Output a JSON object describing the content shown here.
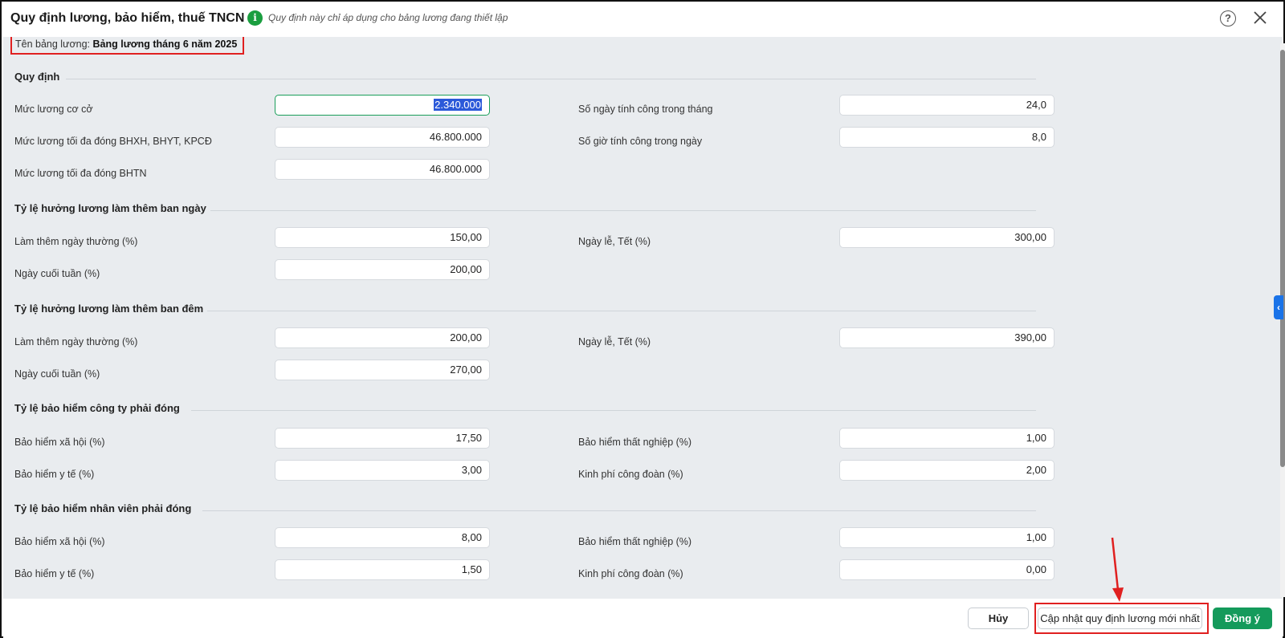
{
  "dialog": {
    "title": "Quy định lương, bảo hiểm, thuế TNCN",
    "info_note": "Quy định này chỉ áp dụng cho bảng lương đang thiết lập",
    "help_symbol": "?",
    "icons": {
      "info": "info-icon",
      "help": "help-circle-icon",
      "close": "close-icon",
      "side": "chevron-left-icon"
    },
    "colors": {
      "accent": "#149a5b",
      "highlight": "#e02020",
      "info": "#1a9e3f",
      "selection": "#2b59d9"
    }
  },
  "payroll": {
    "label": "Tên bảng lương:",
    "name": "Bảng lương tháng 6 năm 2025"
  },
  "sections": {
    "regulation": {
      "title": "Quy định",
      "base_salary": {
        "label": "Mức lương cơ cở",
        "value": "2.340.000"
      },
      "max_bhxh": {
        "label": "Mức lương tối đa đóng BHXH, BHYT, KPCĐ",
        "value": "46.800.000"
      },
      "max_bhtn": {
        "label": "Mức lương tối đa đóng BHTN",
        "value": "46.800.000"
      },
      "work_days": {
        "label": "Số ngày tính công trong tháng",
        "value": "24,0"
      },
      "work_hours": {
        "label": "Số giờ tính công trong ngày",
        "value": "8,0"
      }
    },
    "overtime_day": {
      "title": "Tỷ lệ hưởng lương làm thêm ban ngày",
      "weekday": {
        "label": "Làm thêm ngày thường (%)",
        "value": "150,00"
      },
      "weekend": {
        "label": "Ngày cuối tuần (%)",
        "value": "200,00"
      },
      "holiday": {
        "label": "Ngày lễ, Tết (%)",
        "value": "300,00"
      }
    },
    "overtime_night": {
      "title": "Tỷ lệ hưởng lương làm thêm ban đêm",
      "weekday": {
        "label": "Làm thêm ngày thường (%)",
        "value": "200,00"
      },
      "weekend": {
        "label": "Ngày cuối tuần (%)",
        "value": "270,00"
      },
      "holiday": {
        "label": "Ngày lễ, Tết (%)",
        "value": "390,00"
      }
    },
    "company_insurance": {
      "title": "Tỷ lệ bảo hiểm công ty phải đóng",
      "social": {
        "label": "Bảo hiểm xã hội (%)",
        "value": "17,50"
      },
      "health": {
        "label": "Bảo hiểm y tế (%)",
        "value": "3,00"
      },
      "unemployment": {
        "label": "Bảo hiểm thất nghiệp (%)",
        "value": "1,00"
      },
      "union": {
        "label": "Kinh phí công đoàn (%)",
        "value": "2,00"
      }
    },
    "employee_insurance": {
      "title": "Tỷ lệ bảo hiểm nhân viên phải đóng",
      "social": {
        "label": "Bảo hiểm xã hội (%)",
        "value": "8,00"
      },
      "health": {
        "label": "Bảo hiểm y tế (%)",
        "value": "1,50"
      },
      "unemployment": {
        "label": "Bảo hiểm thất nghiệp (%)",
        "value": "1,00"
      },
      "union": {
        "label": "Kinh phí công đoàn (%)",
        "value": "0,00"
      }
    }
  },
  "footer": {
    "cancel_label": "Hủy",
    "update_label": "Cập nhật quy định lương mới nhất",
    "ok_label": "Đồng ý"
  }
}
